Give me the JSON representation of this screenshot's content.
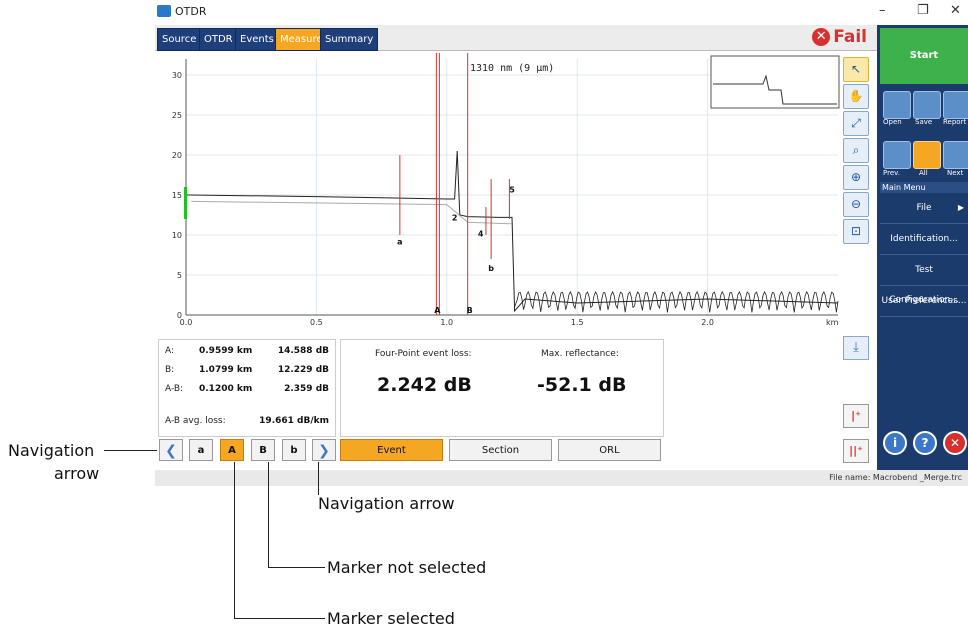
{
  "window": {
    "title": "OTDR",
    "minimize": "–",
    "restore": "❐",
    "close": "✕"
  },
  "tabs": [
    {
      "label": "Source"
    },
    {
      "label": "OTDR"
    },
    {
      "label": "Events"
    },
    {
      "label": "Measure"
    },
    {
      "label": "Summary"
    }
  ],
  "status": {
    "fail_label": "Fail",
    "fail_icon": "fail-icon"
  },
  "graph": {
    "wavelength": "1310 nm (9 µm)",
    "unit": "km",
    "y_ticks": [
      "30",
      "25",
      "20",
      "15",
      "10",
      "5",
      "0"
    ],
    "x_ticks": [
      "0.0",
      "0.5",
      "1.0",
      "1.5",
      "2.0"
    ],
    "markers": {
      "A": "A",
      "B": "B",
      "a": "a",
      "b": "b"
    },
    "event_numbers": [
      "2",
      "4",
      "5"
    ]
  },
  "chart_data": {
    "type": "line",
    "title": "1310 nm (9 µm)",
    "xlabel": "km",
    "ylabel": "",
    "xlim": [
      0,
      2.5
    ],
    "ylim": [
      0,
      32
    ],
    "series": [
      {
        "x": [
          0.0,
          0.02,
          0.5,
          1.0,
          1.03,
          1.04,
          1.05,
          1.08,
          1.2,
          1.25,
          1.26,
          1.3,
          1.5,
          2.0,
          2.5
        ],
        "y": [
          15,
          15,
          14.8,
          14.5,
          14.5,
          20.5,
          12.5,
          12.3,
          12.2,
          12.2,
          0.5,
          2,
          1.5,
          2,
          1.5
        ]
      }
    ]
  },
  "measure": {
    "A_label": "A:",
    "A_dist": "0.9599 km",
    "A_val": "14.588 dB",
    "B_label": "B:",
    "B_dist": "1.0799 km",
    "B_val": "12.229 dB",
    "AB_label": "A-B:",
    "AB_dist": "0.1200 km",
    "AB_val": "2.359 dB",
    "avg_label": "A-B avg. loss:",
    "avg_val": "19.661 dB/km"
  },
  "event_result": {
    "loss_label": "Four-Point event loss:",
    "loss_val": "2.242 dB",
    "refl_label": "Max. reflectance:",
    "refl_val": "-52.1 dB"
  },
  "marker_buttons": {
    "prev": "❮",
    "a": "a",
    "A": "A",
    "B": "B",
    "b": "b",
    "next": "❯"
  },
  "mode_buttons": {
    "event": "Event",
    "section": "Section",
    "orl": "ORL"
  },
  "side": {
    "start": "Start",
    "open": "Open",
    "save": "Save",
    "report": "Report",
    "prev": "Prev.",
    "all": "All",
    "next": "Next",
    "main_menu": "Main Menu",
    "menu": [
      "File",
      "Identification...",
      "Test Configuration...",
      "User Preferences..."
    ],
    "file_arrow": "▶"
  },
  "statusbar": {
    "file": "File name: Macrobend _Merge.trc"
  },
  "annotations": {
    "nav_left_1": "Navigation",
    "nav_left_2": "arrow",
    "nav_right": "Navigation arrow",
    "not_selected": "Marker not selected",
    "selected": "Marker selected"
  },
  "colors": {
    "accent": "#f5a623",
    "navy": "#1b3b6d",
    "fail": "#d8302c",
    "start": "#3db24a"
  }
}
